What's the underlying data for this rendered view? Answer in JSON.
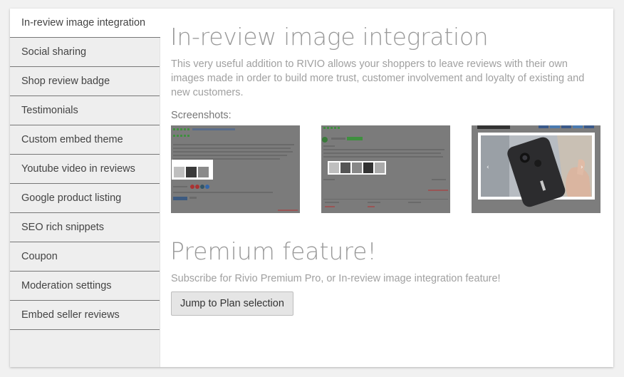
{
  "sidebar": {
    "items": [
      {
        "label": "In-review image integration",
        "active": true
      },
      {
        "label": "Social sharing"
      },
      {
        "label": "Shop review badge"
      },
      {
        "label": "Testimonials"
      },
      {
        "label": "Custom embed theme"
      },
      {
        "label": "Youtube video in reviews"
      },
      {
        "label": "Google product listing"
      },
      {
        "label": "SEO rich snippets"
      },
      {
        "label": "Coupon"
      },
      {
        "label": "Moderation settings"
      },
      {
        "label": "Embed seller reviews"
      }
    ]
  },
  "main": {
    "title": "In-review image integration",
    "description": "This very useful addition to RIVIO allows your shoppers to leave reviews with their own images made in order to build more trust, customer involvement and loyalty of existing and new customers.",
    "screenshots_label": "Screenshots:",
    "premium_title": "Premium feature!",
    "premium_text": "Subscribe for Rivio Premium Pro, or In-review image integration feature!",
    "plan_button": "Jump to Plan selection"
  },
  "colors": {
    "accent_green": "#3a9a3a",
    "button_bg": "#e5e5e5",
    "text_muted": "#999999"
  }
}
